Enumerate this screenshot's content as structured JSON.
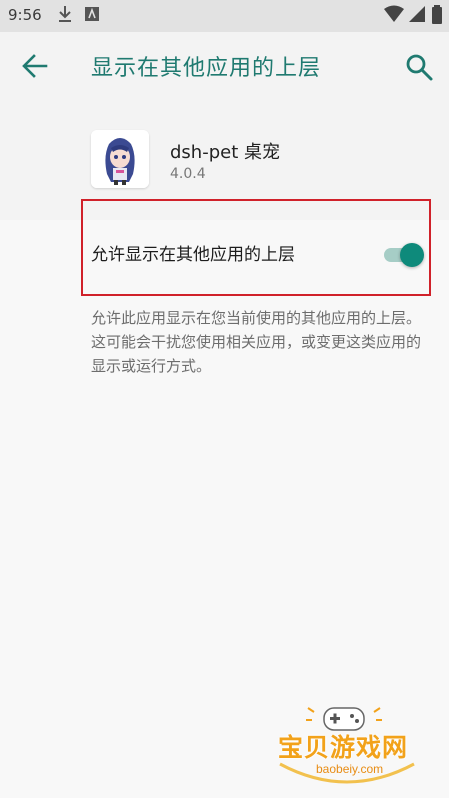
{
  "status_bar": {
    "time": "9:56"
  },
  "app_bar": {
    "title": "显示在其他应用的上层"
  },
  "app": {
    "name": "dsh-pet 桌宠",
    "version": "4.0.4"
  },
  "setting": {
    "label": "允许显示在其他应用的上层",
    "enabled": true
  },
  "description": "允许此应用显示在您当前使用的其他应用的上层。这可能会干扰您使用相关应用，或变更这类应用的显示或运行方式。",
  "watermark": {
    "text": "宝贝游戏网",
    "url": "baobeiy.com"
  },
  "colors": {
    "accent": "#1f7a70",
    "switch_on": "#0e8a7b",
    "highlight_border": "#d0212a"
  }
}
